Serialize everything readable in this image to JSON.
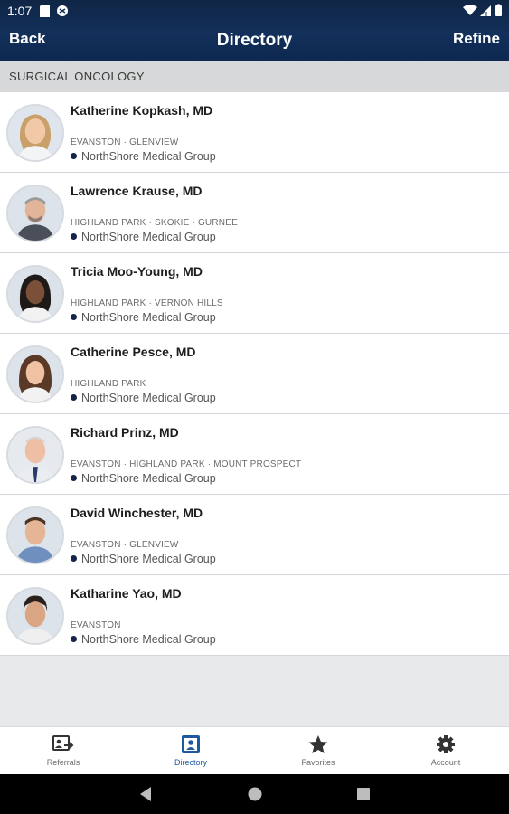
{
  "status_bar": {
    "time": "1:07"
  },
  "header": {
    "back_label": "Back",
    "title": "Directory",
    "refine_label": "Refine"
  },
  "section": {
    "title": "SURGICAL ONCOLOGY"
  },
  "colors": {
    "header_bg": "#12305a",
    "accent": "#1e5aa0",
    "group_dot": "#15224a"
  },
  "doctors": [
    {
      "name": "Katherine Kopkash, MD",
      "locations": "EVANSTON · GLENVIEW",
      "group": "NorthShore Medical Group"
    },
    {
      "name": "Lawrence Krause, MD",
      "locations": "HIGHLAND PARK · SKOKIE · GURNEE",
      "group": "NorthShore Medical Group"
    },
    {
      "name": "Tricia Moo-Young, MD",
      "locations": "HIGHLAND PARK · VERNON HILLS",
      "group": "NorthShore Medical Group"
    },
    {
      "name": "Catherine Pesce, MD",
      "locations": "HIGHLAND PARK",
      "group": "NorthShore Medical Group"
    },
    {
      "name": "Richard Prinz, MD",
      "locations": "EVANSTON · HIGHLAND PARK · MOUNT PROSPECT",
      "group": "NorthShore Medical Group"
    },
    {
      "name": "David Winchester, MD",
      "locations": "EVANSTON · GLENVIEW",
      "group": "NorthShore Medical Group"
    },
    {
      "name": "Katharine Yao, MD",
      "locations": "EVANSTON",
      "group": "NorthShore Medical Group"
    }
  ],
  "tabs": [
    {
      "label": "Referrals",
      "icon": "referrals-icon"
    },
    {
      "label": "Directory",
      "icon": "directory-icon",
      "active": true
    },
    {
      "label": "Favorites",
      "icon": "star-icon"
    },
    {
      "label": "Account",
      "icon": "gear-icon"
    }
  ]
}
